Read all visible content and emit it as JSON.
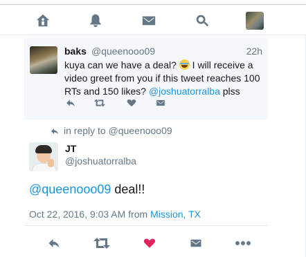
{
  "nav": {
    "items": [
      {
        "name": "home-icon"
      },
      {
        "name": "notifications-icon"
      },
      {
        "name": "messages-icon"
      },
      {
        "name": "search-icon"
      },
      {
        "name": "profile-avatar"
      }
    ]
  },
  "parent_tweet": {
    "display_name": "baks",
    "handle": "@queenooo09",
    "time": "22h",
    "text_1": "kuya can we have a deal? ",
    "text_2": " I will receive a video greet from you if this tweet reaches 100 RTs and 150 likes? ",
    "mention": "@joshuatorralba",
    "text_3": " plss",
    "emoji": "face-with-tears-of-joy",
    "actions": [
      "reply-icon",
      "retweet-icon",
      "like-icon",
      "message-icon"
    ]
  },
  "reply_context": {
    "text": "in reply to @queenooo09"
  },
  "main_tweet": {
    "display_name": "JT",
    "handle": "@joshuatorralba",
    "mention": "@queenooo09",
    "text": " deal!!",
    "timestamp": "Oct 22, 2016, 9:03 AM from ",
    "place": "Mission, TX",
    "actions": [
      "reply-icon",
      "retweet-icon",
      "like-icon",
      "message-icon",
      "more-icon"
    ],
    "like_color": "#e0245e"
  },
  "colors": {
    "accent": "#1b95e0",
    "muted": "#657786",
    "like": "#e0245e"
  }
}
